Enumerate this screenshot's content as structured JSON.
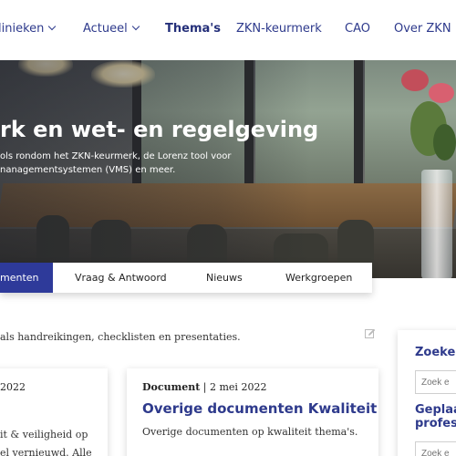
{
  "nav": {
    "items": [
      {
        "label": "linieken",
        "dropdown": true
      },
      {
        "label": "Actueel",
        "dropdown": true
      },
      {
        "label": "Thema's",
        "active": true
      },
      {
        "label": "ZKN-keurmerk"
      },
      {
        "label": "CAO"
      },
      {
        "label": "Over ZKN"
      }
    ]
  },
  "hero": {
    "title": "rk en wet- en regelgeving",
    "lines": [
      "ols rondom het ZKN-keurmerk, de Lorenz tool voor",
      "nanagementsystemen (VMS) en meer."
    ]
  },
  "tabs": [
    {
      "label": "menten",
      "active": true
    },
    {
      "label": "Vraag & Antwoord"
    },
    {
      "label": "Nieuws"
    },
    {
      "label": "Werkgroepen"
    }
  ],
  "intro": "als handreikingen, checklisten en presentaties.",
  "cards": [
    {
      "type": "",
      "date": "2022",
      "title": "",
      "lines": [
        "it & veiligheid op",
        "el vernieuwd. Alle"
      ]
    },
    {
      "type": "Document",
      "date": "2 mei 2022",
      "title": "Overige documenten Kwaliteit",
      "lines": [
        "Overige documenten op kwaliteit thema's."
      ]
    }
  ],
  "sidebar": {
    "search_heading": "Zoeken",
    "second_heading_lines": [
      "Geplaa",
      "profes"
    ],
    "input_placeholder": "Zoek e"
  },
  "colors": {
    "brand": "#2e3a8c",
    "active_tab": "#2e3a9a"
  }
}
